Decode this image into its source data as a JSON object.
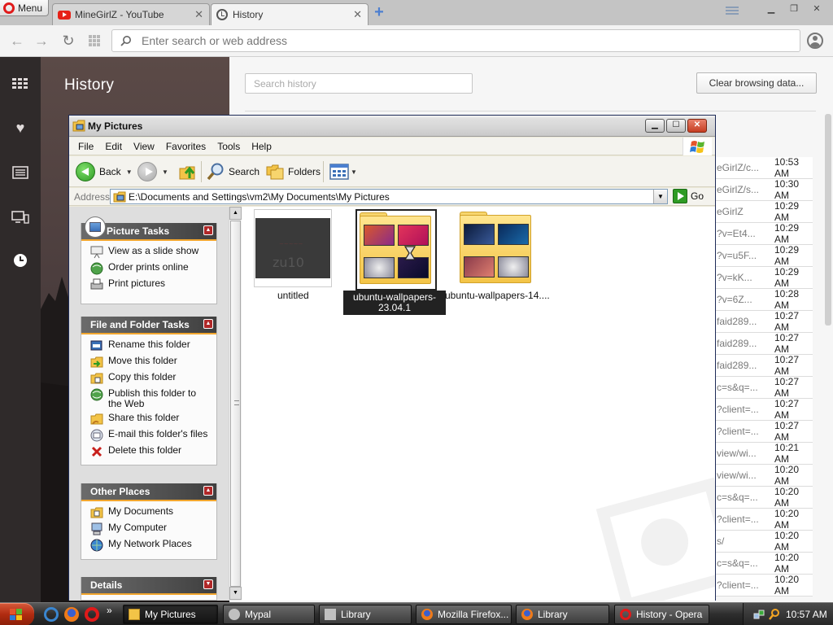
{
  "browser": {
    "menu_label": "Menu",
    "tabs": [
      {
        "title": "MineGirlZ - YouTube",
        "icon": "youtube-icon",
        "active": false
      },
      {
        "title": "History",
        "icon": "history-clock-icon",
        "active": true
      }
    ],
    "address_placeholder": "Enter search or web address",
    "sidebar_icons": [
      "speed-dial-icon",
      "heart-icon",
      "news-icon",
      "tab-sync-icon",
      "history-clock-icon"
    ]
  },
  "history": {
    "title": "History",
    "search_placeholder": "Search history",
    "clear_button": "Clear browsing data...",
    "rows": [
      {
        "url": "eGirlZ/c...",
        "time": "10:53 AM"
      },
      {
        "url": "eGirlZ/s...",
        "time": "10:30 AM"
      },
      {
        "url": "eGirlZ",
        "time": "10:29 AM"
      },
      {
        "url": "?v=Et4...",
        "time": "10:29 AM"
      },
      {
        "url": "?v=u5F...",
        "time": "10:29 AM"
      },
      {
        "url": "?v=kK...",
        "time": "10:29 AM"
      },
      {
        "url": "?v=6Z...",
        "time": "10:28 AM"
      },
      {
        "url": "faid289...",
        "time": "10:27 AM"
      },
      {
        "url": "faid289...",
        "time": "10:27 AM"
      },
      {
        "url": "faid289...",
        "time": "10:27 AM"
      },
      {
        "url": "c=s&q=...",
        "time": "10:27 AM"
      },
      {
        "url": "?client=...",
        "time": "10:27 AM"
      },
      {
        "url": "?client=...",
        "time": "10:27 AM"
      },
      {
        "url": "view/wi...",
        "time": "10:21 AM"
      },
      {
        "url": "view/wi...",
        "time": "10:20 AM"
      },
      {
        "url": "c=s&q=...",
        "time": "10:20 AM"
      },
      {
        "url": "?client=...",
        "time": "10:20 AM"
      },
      {
        "url": "s/",
        "time": "10:20 AM"
      },
      {
        "url": "c=s&q=...",
        "time": "10:20 AM"
      },
      {
        "url": "?client=...",
        "time": "10:20 AM"
      }
    ]
  },
  "explorer": {
    "title": "My Pictures",
    "menu": [
      "File",
      "Edit",
      "View",
      "Favorites",
      "Tools",
      "Help"
    ],
    "toolbar": {
      "back": "Back",
      "search": "Search",
      "folders": "Folders"
    },
    "address_label": "Address",
    "address_value": "E:\\Documents and Settings\\vm2\\My Documents\\My Pictures",
    "go_label": "Go",
    "picture_tasks": {
      "title": "Picture Tasks",
      "items": [
        "View as a slide show",
        "Order prints online",
        "Print pictures"
      ]
    },
    "file_folder_tasks": {
      "title": "File and Folder Tasks",
      "items": [
        "Rename this folder",
        "Move this folder",
        "Copy this folder",
        "Publish this folder to the Web",
        "Share this folder",
        "E-mail this folder's files",
        "Delete this folder"
      ]
    },
    "other_places": {
      "title": "Other Places",
      "items": [
        "My Documents",
        "My Computer",
        "My Network Places"
      ]
    },
    "details": {
      "title": "Details"
    },
    "files": [
      {
        "name": "untitled",
        "type": "image",
        "selected": false
      },
      {
        "name": "ubuntu-wallpapers-23.04.1",
        "type": "folder",
        "selected": true
      },
      {
        "name": "ubuntu-wallpapers-14....",
        "type": "folder",
        "selected": false
      }
    ]
  },
  "taskbar": {
    "tasks": [
      {
        "label": "My Pictures",
        "active": true
      },
      {
        "label": "Mypal",
        "active": false
      },
      {
        "label": "Library",
        "active": false
      },
      {
        "label": "Mozilla Firefox...",
        "active": false
      },
      {
        "label": "Library",
        "active": false
      },
      {
        "label": "History - Opera",
        "active": false
      }
    ],
    "overflow": "»",
    "clock": "10:57 AM"
  },
  "colors": {
    "opera_red": "#e01a1a",
    "task_header": "#4a4a4a",
    "task_accent": "#f2a62e"
  }
}
